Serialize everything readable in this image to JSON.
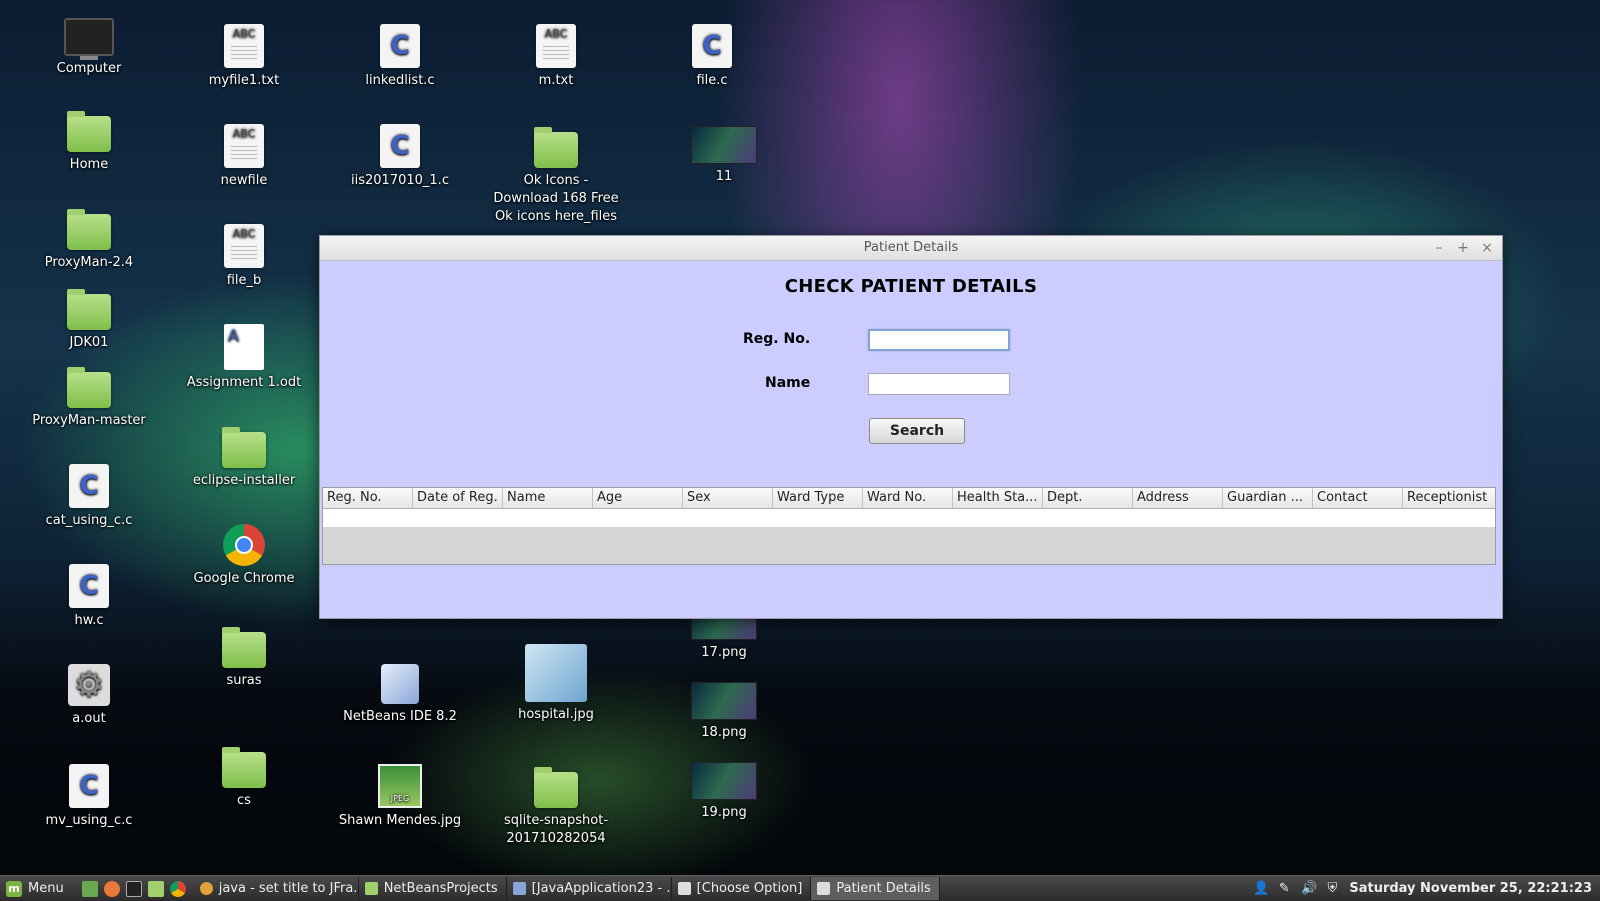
{
  "desktop": {
    "col1": [
      "Computer",
      "Home",
      "ProxyMan-2.4",
      "JDK01",
      "ProxyMan-master",
      "cat_using_c.c",
      "hw.c",
      "a.out",
      "mv_using_c.c"
    ],
    "col2": [
      "myfile1.txt",
      "newfile",
      "file_b",
      "Assignment 1.odt",
      "eclipse-installer",
      "Google Chrome",
      "suras",
      "cs"
    ],
    "col3": [
      "linkedlist.c",
      "iis2017010_1.c",
      "NetBeans IDE 8.2",
      "Shawn Mendes.jpg"
    ],
    "col4": [
      "m.txt",
      "Ok Icons - Download 168 Free Ok icons here_files",
      "hospital.jpg",
      "sqlite-snapshot-201710282054"
    ],
    "col5": [
      "file.c",
      "11",
      "17.png",
      "18.png",
      "19.png"
    ],
    "abc_label": "ABC",
    "c_label": "C",
    "jpeg_label": "JPEG"
  },
  "dialog": {
    "title": "Patient Details",
    "heading": "CHECK PATIENT DETAILS",
    "reg_label": "Reg. No.",
    "reg_value": "",
    "name_label": "Name",
    "name_value": "",
    "search_label": "Search",
    "controls": {
      "minimize": "–",
      "maximize": "+",
      "close": "×"
    },
    "columns": [
      "Reg. No.",
      "Date of Reg.",
      "Name",
      "Age",
      "Sex",
      "Ward Type",
      "Ward No.",
      "Health Sta...",
      "Dept.",
      "Address",
      "Guardian ...",
      "Contact",
      "Receptionist"
    ]
  },
  "taskbar": {
    "menu_label": "Menu",
    "tasks": [
      "java - set title to JFra...",
      "NetBeansProjects",
      "[JavaApplication23 - ...",
      "[Choose Option]",
      "Patient Details"
    ],
    "clock": "Saturday November 25, 22:21:23"
  },
  "colors": {
    "dialog_bg": "#ccccff",
    "taskbar_bg": "#2c2c2c",
    "folder": "#9fd06d"
  }
}
